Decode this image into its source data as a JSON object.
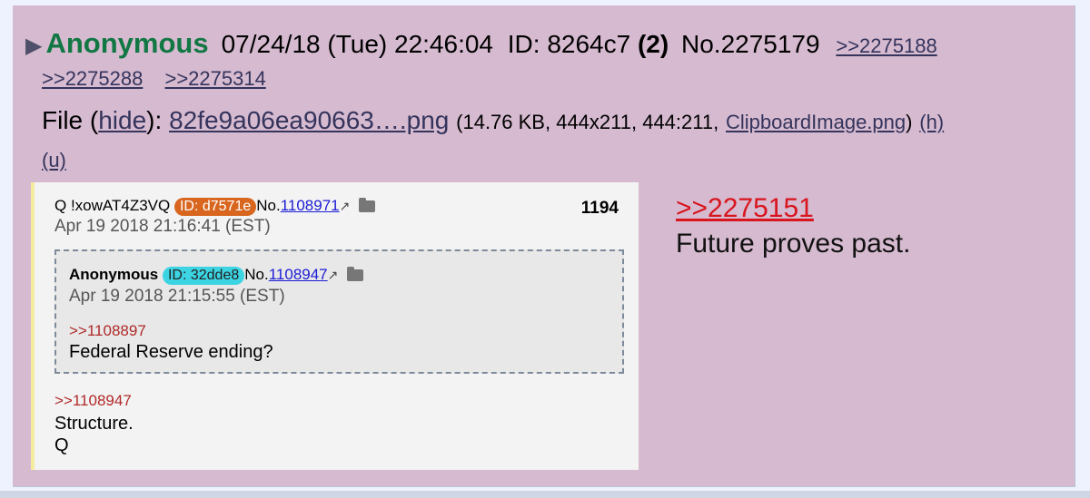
{
  "header": {
    "arrow": "▶",
    "name": "Anonymous",
    "datetime": "07/24/18 (Tue) 22:46:04",
    "id_label": "ID: 8264c7",
    "post_count": "(2)",
    "post_no": "No.2275179",
    "replies": [
      ">>2275188",
      ">>2275288",
      ">>2275314"
    ]
  },
  "file": {
    "label": "File",
    "hide_open": "(",
    "hide_label": "hide",
    "hide_close": "):",
    "filename": "82fe9a06ea90663….png",
    "info_open": "(14.76 KB, 444x211, 444:211,",
    "original_name": "ClipboardImage.png",
    "info_close": ")",
    "h_label": "(h)",
    "u_label": "(u)"
  },
  "embedded": {
    "tripcode": "Q !xowAT4Z3VQ",
    "id_badge": "ID: d7571e",
    "no_prefix": "No.",
    "no_link": "1108971",
    "date": "Apr 19 2018 21:16:41 (EST)",
    "count": "1194",
    "inner": {
      "name": "Anonymous",
      "id_badge": "ID: 32dde8",
      "no_prefix": "No.",
      "no_link": "1108947",
      "date": "Apr 19 2018 21:15:55 (EST)",
      "ref": ">>1108897",
      "text": "Federal Reserve ending?"
    },
    "ref": ">>1108947",
    "text_line1": "Structure.",
    "text_line2": "Q"
  },
  "comment": {
    "ref": ">>2275151",
    "text": "Future proves past."
  },
  "colors": {
    "post_bg": "#d6bad0",
    "name_green": "#117743",
    "link": "#34345c",
    "quote_red": "#d8141c"
  }
}
